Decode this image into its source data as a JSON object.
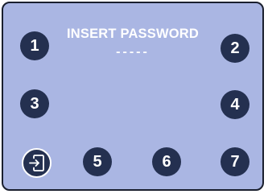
{
  "keypad": {
    "title": "INSERT PASSWORD",
    "code_display": "-----",
    "keys": [
      "1",
      "2",
      "3",
      "4",
      "5",
      "6",
      "7"
    ]
  },
  "icons": {
    "exit": "exit-icon"
  },
  "colors": {
    "panel_background": "#aab6e3",
    "key_background": "#243050",
    "text": "#ffffff"
  }
}
